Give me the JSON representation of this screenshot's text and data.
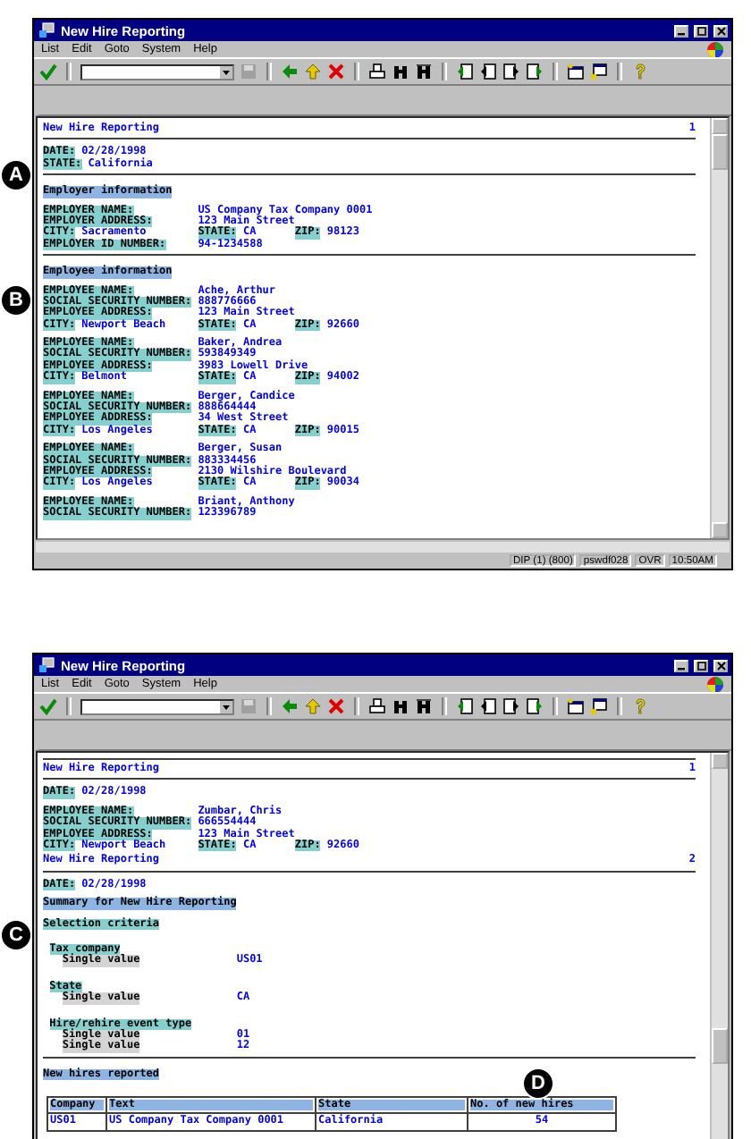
{
  "callouts": [
    "A",
    "B",
    "C",
    "D"
  ],
  "windows": [
    {
      "title": "New Hire Reporting",
      "menu": [
        "List",
        "Edit",
        "Goto",
        "System",
        "Help"
      ],
      "report": [
        {
          "kind": "header",
          "title": "New Hire Reporting",
          "page": "1"
        },
        {
          "kind": "rule"
        },
        {
          "kind": "fields",
          "lines": [
            [
              {
                "label": "DATE:",
                "value": "02/28/1998"
              }
            ],
            [
              {
                "label": "STATE:",
                "value": "California"
              }
            ]
          ]
        },
        {
          "kind": "rule"
        },
        {
          "kind": "section_heading",
          "text": "Employer information"
        },
        {
          "kind": "fields",
          "lines": [
            [
              {
                "label": "EMPLOYER NAME:"
              },
              {
                "value": "US Company Tax Company 0001"
              }
            ],
            [
              {
                "label": "EMPLOYER ADDRESS:"
              },
              {
                "value": "123 Main Street"
              }
            ],
            [
              {
                "label": "CITY:",
                "value": "Sacramento"
              },
              {
                "label": "STATE:",
                "value": "CA"
              },
              {
                "label": "ZIP:",
                "value": "98123"
              }
            ],
            [
              {
                "label": "EMPLOYER ID NUMBER:"
              },
              {
                "value": "94-1234588"
              }
            ]
          ]
        },
        {
          "kind": "rule"
        },
        {
          "kind": "section_heading",
          "text": "Employee information"
        },
        {
          "kind": "fields",
          "lines": [
            [
              {
                "label": "EMPLOYEE NAME:"
              },
              {
                "value": "Ache, Arthur"
              }
            ],
            [
              {
                "label": "SOCIAL SECURITY NUMBER:"
              },
              {
                "value": "888776666"
              }
            ],
            [
              {
                "label": "EMPLOYEE ADDRESS:"
              },
              {
                "value": "123 Main Street"
              }
            ],
            [
              {
                "label": "CITY:",
                "value": "Newport Beach"
              },
              {
                "label": "STATE:",
                "value": "CA"
              },
              {
                "label": "ZIP:",
                "value": "92660"
              }
            ]
          ]
        },
        {
          "kind": "fields",
          "lines": [
            [
              {
                "label": "EMPLOYEE NAME:"
              },
              {
                "value": "Baker, Andrea"
              }
            ],
            [
              {
                "label": "SOCIAL SECURITY NUMBER:"
              },
              {
                "value": "593849349"
              }
            ],
            [
              {
                "label": "EMPLOYEE ADDRESS:"
              },
              {
                "value": "3983 Lowell Drive"
              }
            ],
            [
              {
                "label": "CITY:",
                "value": "Belmont"
              },
              {
                "label": "STATE:",
                "value": "CA"
              },
              {
                "label": "ZIP:",
                "value": "94002"
              }
            ]
          ]
        },
        {
          "kind": "fields",
          "lines": [
            [
              {
                "label": "EMPLOYEE NAME:"
              },
              {
                "value": "Berger, Candice"
              }
            ],
            [
              {
                "label": "SOCIAL SECURITY NUMBER:"
              },
              {
                "value": "888664444"
              }
            ],
            [
              {
                "label": "EMPLOYEE ADDRESS:"
              },
              {
                "value": "34 West Street"
              }
            ],
            [
              {
                "label": "CITY:",
                "value": "Los Angeles"
              },
              {
                "label": "STATE:",
                "value": "CA"
              },
              {
                "label": "ZIP:",
                "value": "90015"
              }
            ]
          ]
        },
        {
          "kind": "fields",
          "lines": [
            [
              {
                "label": "EMPLOYEE NAME:"
              },
              {
                "value": "Berger, Susan"
              }
            ],
            [
              {
                "label": "SOCIAL SECURITY NUMBER:"
              },
              {
                "value": "883334456"
              }
            ],
            [
              {
                "label": "EMPLOYEE ADDRESS:"
              },
              {
                "value": "2130 Wilshire Boulevard"
              }
            ],
            [
              {
                "label": "CITY:",
                "value": "Los Angeles"
              },
              {
                "label": "STATE:",
                "value": "CA"
              },
              {
                "label": "ZIP:",
                "value": "90034"
              }
            ]
          ]
        },
        {
          "kind": "fields",
          "lines": [
            [
              {
                "label": "EMPLOYEE NAME:"
              },
              {
                "value": "Briant, Anthony"
              }
            ],
            [
              {
                "label": "SOCIAL SECURITY NUMBER:"
              },
              {
                "value": "123396789"
              }
            ]
          ]
        }
      ],
      "status_bar": [
        "DIP (1) (800)",
        "pswdf028",
        "OVR",
        "10:50AM"
      ]
    },
    {
      "title": "New Hire Reporting",
      "menu": [
        "List",
        "Edit",
        "Goto",
        "System",
        "Help"
      ],
      "report": [
        {
          "kind": "rule"
        },
        {
          "kind": "header",
          "title": "New Hire Reporting",
          "page": "1"
        },
        {
          "kind": "rule"
        },
        {
          "kind": "fields",
          "lines": [
            [
              {
                "label": "DATE:",
                "value": "02/28/1998"
              }
            ]
          ]
        },
        {
          "kind": "fields",
          "lines": [
            [
              {
                "label": "EMPLOYEE NAME:"
              },
              {
                "value": "Zumbar, Chris"
              }
            ],
            [
              {
                "label": "SOCIAL SECURITY NUMBER:"
              },
              {
                "value": "666554444"
              }
            ],
            [
              {
                "label": "EMPLOYEE ADDRESS:"
              },
              {
                "value": "123 Main Street"
              }
            ],
            [
              {
                "label": "CITY:",
                "value": "Newport Beach"
              },
              {
                "label": "STATE:",
                "value": "CA"
              },
              {
                "label": "ZIP:",
                "value": "92660"
              }
            ]
          ]
        },
        {
          "kind": "header",
          "title": "New Hire Reporting",
          "page": "2"
        },
        {
          "kind": "rule"
        },
        {
          "kind": "fields",
          "lines": [
            [
              {
                "label": "DATE:",
                "value": "02/28/1998"
              }
            ]
          ]
        },
        {
          "kind": "section_heading",
          "text": "Summary for New Hire Reporting"
        },
        {
          "kind": "group_heading",
          "text": "Selection criteria"
        },
        {
          "kind": "criteria",
          "group": "Tax company",
          "values": [
            {
              "label": "Single value",
              "value": "US01"
            }
          ]
        },
        {
          "kind": "criteria",
          "group": "State",
          "values": [
            {
              "label": "Single value",
              "value": "CA"
            }
          ]
        },
        {
          "kind": "criteria",
          "group": "Hire/rehire event type",
          "values": [
            {
              "label": "Single value",
              "value": "01"
            },
            {
              "label": "Single value",
              "value": "12"
            }
          ]
        },
        {
          "kind": "rule"
        },
        {
          "kind": "section_heading",
          "text": "New hires reported"
        },
        {
          "kind": "table",
          "columns": [
            "Company",
            "Text",
            "State",
            "No. of new hires"
          ],
          "rows": [
            [
              "US01",
              "US Company Tax Company 0001",
              "California",
              "54"
            ]
          ]
        }
      ]
    }
  ]
}
